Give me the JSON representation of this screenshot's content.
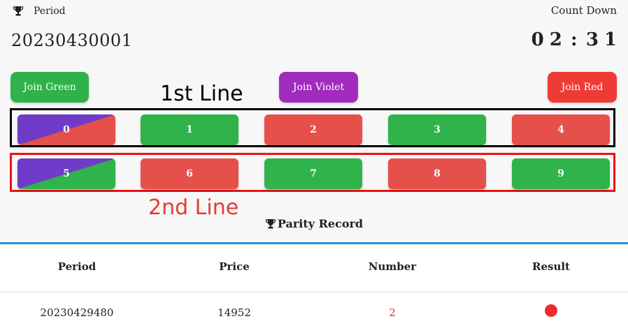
{
  "header": {
    "period_label": "Period",
    "period_value": "20230430001",
    "countdown_label": "Count Down",
    "countdown_digits": [
      "0",
      "2",
      ":",
      "3",
      "1"
    ]
  },
  "join_buttons": {
    "green": "Join Green",
    "violet": "Join Violet",
    "red": "Join Red"
  },
  "annotations": {
    "line1": "1st Line",
    "line2": "2nd Line"
  },
  "numbers": {
    "line1": [
      "0",
      "1",
      "2",
      "3",
      "4"
    ],
    "line2": [
      "5",
      "6",
      "7",
      "8",
      "9"
    ]
  },
  "record": {
    "title": "Parity Record",
    "columns": [
      "Period",
      "Price",
      "Number",
      "Result"
    ],
    "rows": [
      {
        "period": "20230429480",
        "price": "14952",
        "number": "2",
        "result_color": "red"
      }
    ]
  },
  "colors": {
    "green": "#30b34b",
    "red": "#e5504a",
    "violet": "#6f3bc8",
    "accent_blue": "#2b8ce4"
  }
}
